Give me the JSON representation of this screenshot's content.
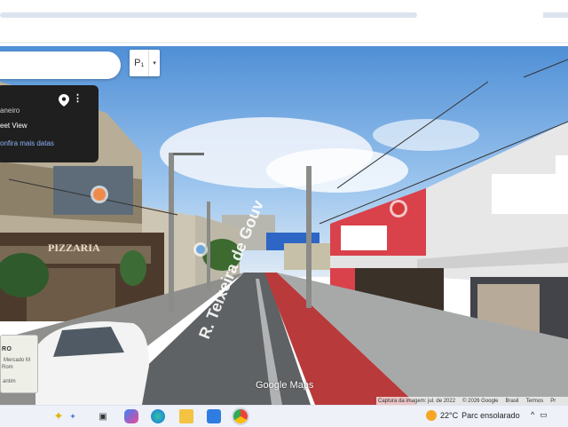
{
  "street_view": {
    "location_fragment": "aneiro",
    "label": "eet View",
    "more_dates": "onfira mais datas",
    "street_name": "R. Teixeira de Gouv",
    "shop_sign": "PIZZARIA",
    "watermark": "Google Maps",
    "pegman_label": "P₁",
    "pegman_dropdown": "▾"
  },
  "minimap": {
    "line1": "RO",
    "line2": "Mercado M",
    "line3": "Rom",
    "line4": "antim"
  },
  "credits": {
    "capture": "Captura da imagem: jul. de 2022",
    "copyright": "© 2026 Google",
    "country": "Brasil",
    "terms": "Termos",
    "privacy": "Pr"
  },
  "taskbar": {
    "apps": [
      {
        "name": "sparkle-icon",
        "glyph": "✦"
      },
      {
        "name": "task-view-icon",
        "glyph": "▣"
      },
      {
        "name": "copilot-icon",
        "glyph": "◉"
      },
      {
        "name": "edge-icon",
        "glyph": "◐"
      },
      {
        "name": "file-explorer-icon",
        "glyph": "▬"
      },
      {
        "name": "store-icon",
        "glyph": "◆"
      },
      {
        "name": "chrome-icon",
        "glyph": "●"
      }
    ],
    "temperature": "22°C",
    "weather": "Parc ensolarado",
    "tray_chevron": "^"
  },
  "colors": {
    "sky": "#7fb0e4",
    "bike_lane": "#c0393a",
    "info_card": "#1f1f1f",
    "taskbar": "#eef1f8"
  }
}
